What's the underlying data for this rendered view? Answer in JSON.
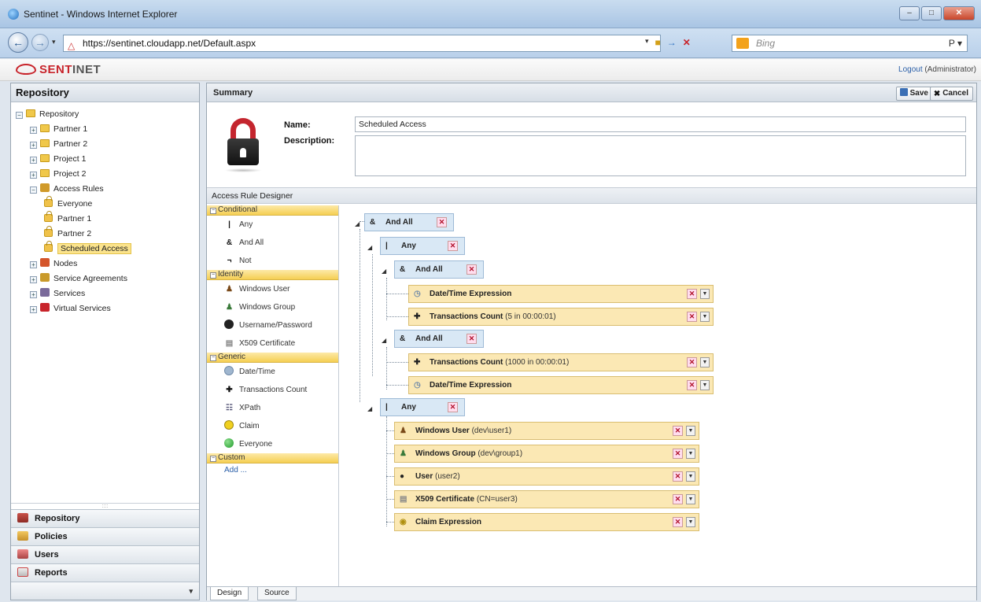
{
  "window": {
    "title": "Sentinet - Windows Internet Explorer",
    "controls": [
      "–",
      "□",
      "✕"
    ]
  },
  "browser": {
    "url": "https://sentinet.cloudapp.net/Default.aspx",
    "search_placeholder": "Bing",
    "search_icon": "P ▾"
  },
  "app": {
    "logo": "SENTINET",
    "logo_prefix": "SENT",
    "logo_suffix": "INET",
    "logout_link": "Logout",
    "logout_user": " (Administrator)"
  },
  "repository": {
    "title": "Repository",
    "tree": [
      {
        "label": "Repository",
        "level": 0,
        "kind": "folder",
        "expand": "−"
      },
      {
        "label": "Partner 1",
        "level": 1,
        "kind": "folder",
        "expand": "+"
      },
      {
        "label": "Partner 2",
        "level": 1,
        "kind": "folder",
        "expand": "+"
      },
      {
        "label": "Project 1",
        "level": 1,
        "kind": "folder",
        "expand": "+"
      },
      {
        "label": "Project 2",
        "level": 1,
        "kind": "folder",
        "expand": "+"
      },
      {
        "label": "Access Rules",
        "level": 1,
        "kind": "rules",
        "expand": "−"
      },
      {
        "label": "Everyone",
        "level": 2,
        "kind": "lock"
      },
      {
        "label": "Partner 1",
        "level": 2,
        "kind": "lock"
      },
      {
        "label": "Partner 2",
        "level": 2,
        "kind": "lock"
      },
      {
        "label": "Scheduled Access",
        "level": 2,
        "kind": "lock",
        "selected": true
      },
      {
        "label": "Nodes",
        "level": 1,
        "kind": "nodes",
        "expand": "+"
      },
      {
        "label": "Service Agreements",
        "level": 1,
        "kind": "agreements",
        "expand": "+"
      },
      {
        "label": "Services",
        "level": 1,
        "kind": "services",
        "expand": "+"
      },
      {
        "label": "Virtual Services",
        "level": 1,
        "kind": "vservices",
        "expand": "+"
      }
    ],
    "grip": "::::",
    "nav": [
      "Repository",
      "Policies",
      "Users",
      "Reports"
    ],
    "nav_drop": "▾"
  },
  "summary": {
    "header": "Summary",
    "save": "Save",
    "cancel": "Cancel",
    "name_label": "Name:",
    "description_label": "Description:",
    "name_value": "Scheduled Access",
    "description_value": ""
  },
  "designer": {
    "title": "Access Rule Designer",
    "sections": [
      {
        "title": "Conditional",
        "items": [
          {
            "label": "Any",
            "icon": "|"
          },
          {
            "label": "And All",
            "icon": "&"
          },
          {
            "label": "Not",
            "icon": "¬"
          }
        ]
      },
      {
        "title": "Identity",
        "items": [
          {
            "label": "Windows User",
            "icon": "user-icon"
          },
          {
            "label": "Windows Group",
            "icon": "group-icon"
          },
          {
            "label": "Username/Password",
            "icon": "username-password-icon"
          },
          {
            "label": "X509 Certificate",
            "icon": "certificate-icon"
          }
        ]
      },
      {
        "title": "Generic",
        "items": [
          {
            "label": "Date/Time",
            "icon": "clock-icon"
          },
          {
            "label": "Transactions Count",
            "icon": "transactions-icon"
          },
          {
            "label": "XPath",
            "icon": "xpath-icon"
          },
          {
            "label": "Claim",
            "icon": "claim-icon"
          },
          {
            "label": "Everyone",
            "icon": "everyone-icon"
          }
        ]
      },
      {
        "title": "Custom",
        "items": []
      }
    ],
    "add_link": "Add ...",
    "rules": {
      "and_all_1": "And All",
      "any_1": "Any",
      "and_all_2": "And All",
      "datetime_1": "Date/Time Expression",
      "trans_1": "Transactions Count",
      "trans_1_arg": " (5 in 00:00:01)",
      "and_all_3": "And All",
      "trans_2": "Transactions Count",
      "trans_2_arg": " (1000 in 00:00:01)",
      "datetime_2": "Date/Time Expression",
      "any_2": "Any",
      "winuser": "Windows User",
      "winuser_arg": " (dev\\user1)",
      "wingroup": "Windows Group",
      "wingroup_arg": " (dev\\group1)",
      "user": "User",
      "user_arg": " (user2)",
      "x509": "X509 Certificate",
      "x509_arg": " (CN=user3)",
      "claim": "Claim Expression"
    },
    "tabs": [
      "Design",
      "Source"
    ]
  }
}
